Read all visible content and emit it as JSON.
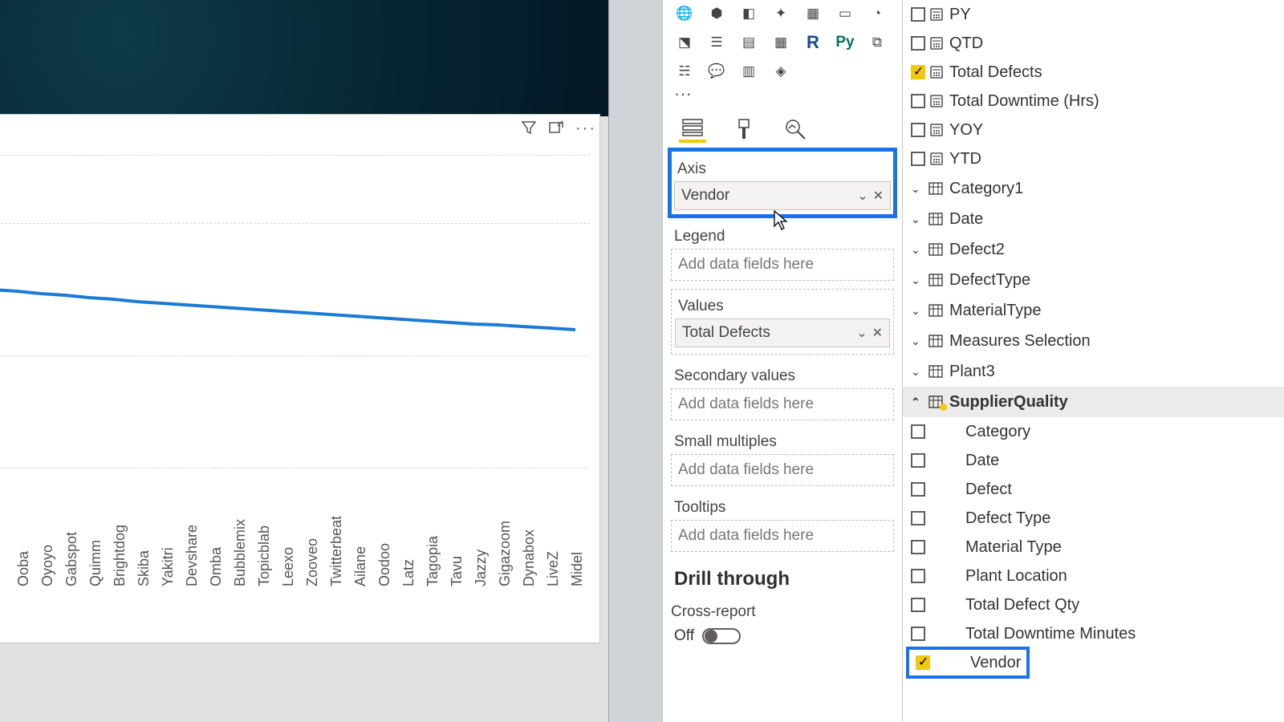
{
  "chart_data": {
    "type": "line",
    "series_name": "Total Defects",
    "categories": [
      "Ooba",
      "Oyoyo",
      "Gabspot",
      "Quimm",
      "Brightdog",
      "Skiba",
      "Yakitri",
      "Devshare",
      "Omba",
      "Bubblemix",
      "Topicblab",
      "Leexo",
      "Zooveo",
      "Twitterbeat",
      "Ailane",
      "Oodoo",
      "Latz",
      "Tagopia",
      "Tavu",
      "Jazzy",
      "Gigazoom",
      "Dynabox",
      "LiveZ",
      "Midel"
    ],
    "values": [
      66,
      65,
      64,
      63,
      62,
      61,
      60,
      59,
      58,
      58,
      57,
      57,
      56,
      56,
      55,
      55,
      54,
      54,
      53,
      53,
      52,
      52,
      51,
      51
    ],
    "xlabel": "Vendor",
    "ylabel": "",
    "ylim": [
      0,
      100
    ],
    "gridlines_y": [
      0,
      20,
      38,
      73,
      100
    ]
  },
  "viz": {
    "more": "···",
    "tab_fields": "Fields",
    "tab_format": "Format",
    "tab_analytics": "Analytics",
    "wells": {
      "axis_label": "Axis",
      "axis_field": "Vendor",
      "legend_label": "Legend",
      "legend_placeholder": "Add data fields here",
      "values_label": "Values",
      "values_field": "Total Defects",
      "secondary_label": "Secondary values",
      "secondary_placeholder": "Add data fields here",
      "smallmult_label": "Small multiples",
      "smallmult_placeholder": "Add data fields here",
      "tooltips_label": "Tooltips",
      "tooltips_placeholder": "Add data fields here"
    },
    "drill_header": "Drill through",
    "cross_report_label": "Cross-report",
    "cross_report_state": "Off"
  },
  "fields": {
    "measures_top": [
      {
        "name": "PY",
        "checked": false
      },
      {
        "name": "QTD",
        "checked": false
      },
      {
        "name": "Total Defects",
        "checked": true
      },
      {
        "name": "Total Downtime (Hrs)",
        "checked": false
      },
      {
        "name": "YOY",
        "checked": false
      },
      {
        "name": "YTD",
        "checked": false
      }
    ],
    "tables_collapsed": [
      "Category1",
      "Date",
      "Defect2",
      "DefectType",
      "MaterialType",
      "Measures Selection",
      "Plant3"
    ],
    "expanded_table": "SupplierQuality",
    "supplier_fields": [
      {
        "name": "Category",
        "checked": false
      },
      {
        "name": "Date",
        "checked": false
      },
      {
        "name": "Defect",
        "checked": false
      },
      {
        "name": "Defect Type",
        "checked": false
      },
      {
        "name": "Material Type",
        "checked": false
      },
      {
        "name": "Plant Location",
        "checked": false
      },
      {
        "name": "Total Defect Qty",
        "checked": false
      },
      {
        "name": "Total Downtime Minutes",
        "checked": false
      },
      {
        "name": "Vendor",
        "checked": true,
        "highlight": true
      }
    ]
  }
}
